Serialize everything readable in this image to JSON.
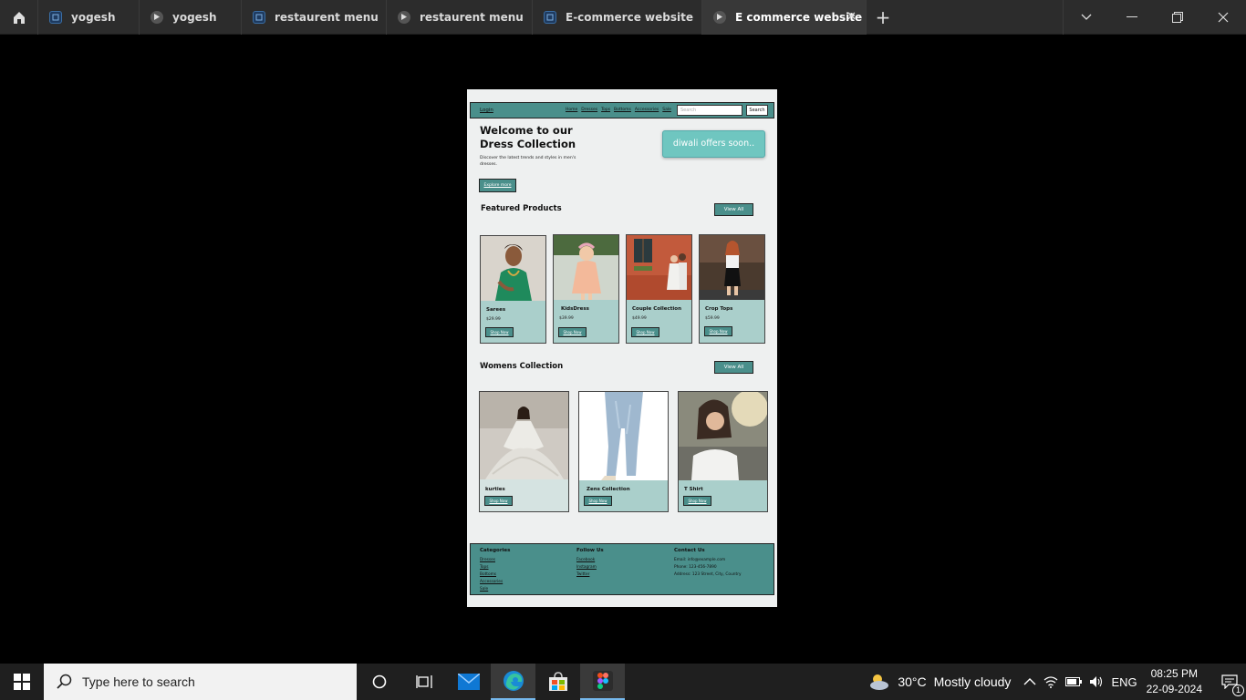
{
  "browser": {
    "tabs": [
      {
        "label": "yogesh",
        "icon": "figma-file-icon",
        "width": 111
      },
      {
        "label": "yogesh",
        "icon": "prototype-play-icon",
        "width": 112
      },
      {
        "label": "restaurent menu",
        "icon": "figma-file-icon",
        "width": 159
      },
      {
        "label": "restaurent menu",
        "icon": "prototype-play-icon",
        "width": 160
      },
      {
        "label": "E-commerce website",
        "icon": "figma-file-icon",
        "width": 186
      },
      {
        "label": "E commerce website",
        "icon": "prototype-play-icon",
        "width": 180,
        "active": true
      }
    ],
    "close_glyph": "✕",
    "new_tab_glyph": "+"
  },
  "site": {
    "nav": {
      "login": "Login",
      "links": [
        "Home",
        "Dresses",
        "Tops",
        "Bottoms",
        "Accessories",
        "Sale"
      ],
      "search_placeholder": "Search",
      "search_button": "Search"
    },
    "hero": {
      "title": "Welcome to our Dress Collection",
      "subtitle": "Discover the latest trends and styles in men's dresses.",
      "button": "Explore more",
      "banner": "diwali offers soon.."
    },
    "featured": {
      "title": "Featured Products",
      "view_all": "View All",
      "products": [
        {
          "name": "Sarees",
          "price": "$29.99",
          "button": "Shop Now"
        },
        {
          "name": "KidsDress",
          "price": "$39.99",
          "button": "Shop Now"
        },
        {
          "name": "Couple Collection",
          "price": "$49.99",
          "button": "Shop Now"
        },
        {
          "name": "Crop Tops",
          "price": "$59.99",
          "button": "Shop Now"
        }
      ]
    },
    "womens": {
      "title": "Womens Collection",
      "view_all": "View All",
      "products": [
        {
          "name": "kurties",
          "button": "Shop Now"
        },
        {
          "name": "Zens Collection",
          "button": "Shop Now"
        },
        {
          "name": "T Shirt",
          "button": "Shop Now"
        }
      ]
    },
    "footer": {
      "categories_title": "Categories",
      "categories": [
        "Dresses",
        "Tops",
        "Bottoms",
        "Accessories",
        "Sale"
      ],
      "follow_title": "Follow Us",
      "follow": [
        "Facebook",
        "Instagram",
        "Twitter"
      ],
      "contact_title": "Contact Us",
      "email": "Email: info@example.com",
      "phone": "Phone: 123-456-7890",
      "address": "Address: 123 Street, City, Country"
    },
    "colors": {
      "primary": "#4a8f8b",
      "card": "#aacfcb",
      "banner": "#6fc6c0",
      "background": "#eef0f0"
    }
  },
  "taskbar": {
    "search_placeholder": "Type here to search",
    "weather_temp": "30°C",
    "weather_desc": "Mostly cloudy",
    "language": "ENG",
    "time": "08:25 PM",
    "date": "22-09-2024",
    "notification_count": "1"
  }
}
